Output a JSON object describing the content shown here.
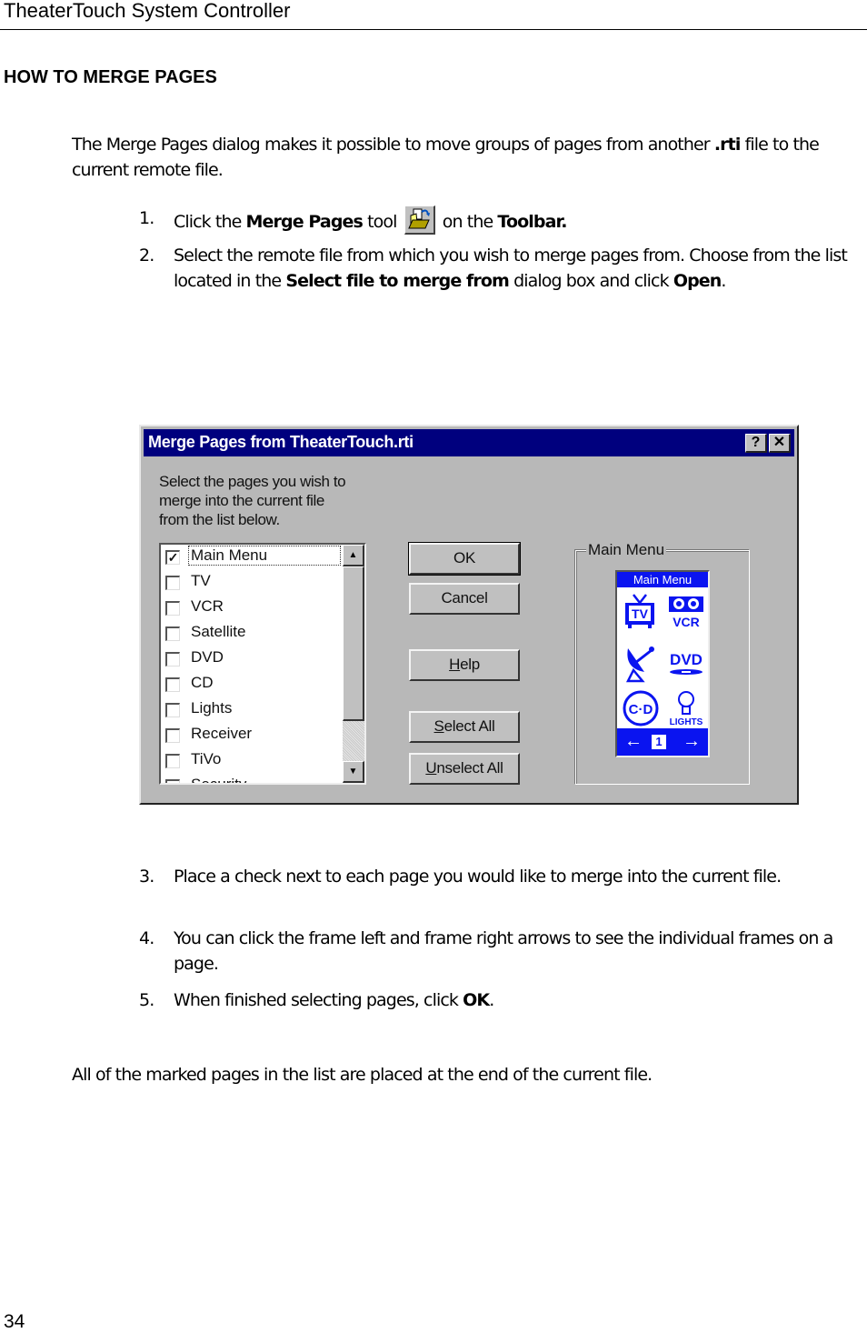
{
  "header": {
    "title": "TheaterTouch System Controller"
  },
  "section": {
    "heading": "HOW TO MERGE PAGES"
  },
  "intro": {
    "text_before": "The Merge Pages dialog makes it possible to move groups of pages from another ",
    "bold_ext": ".rti",
    "text_after": " file to the current remote file."
  },
  "steps": [
    {
      "num": "1.",
      "pre": "Click the ",
      "bold1": "Merge Pages",
      "mid": " tool ",
      "icon": "merge-pages-tool-icon",
      "post": " on the ",
      "bold2": "Toolbar."
    },
    {
      "num": "2.",
      "pre": "Select the remote file from which you wish to merge pages from. Choose from the list located in the ",
      "bold1": "Select file to merge from",
      "mid": " dialog box and click ",
      "bold2": "Open",
      "post": "."
    },
    {
      "num": "3.",
      "text": "Place a check next to each page you would like to merge into the current file."
    },
    {
      "num": "4.",
      "text": "You can click the frame left and frame right arrows to see the individual frames on a page."
    },
    {
      "num": "5.",
      "pre": "When finished selecting pages, click ",
      "bold1": "OK",
      "post": "."
    }
  ],
  "closing": "All of the marked pages in the list are placed at the end of the current file.",
  "page_number": "34",
  "dialog": {
    "title": "Merge Pages from TheaterTouch.rti",
    "help_btn": "?",
    "close_btn": "✕",
    "instructions": [
      "Select the pages you wish to",
      "merge into the current file",
      "from the list below."
    ],
    "pages": [
      {
        "label": "Main Menu",
        "checked": true
      },
      {
        "label": "TV",
        "checked": false
      },
      {
        "label": "VCR",
        "checked": false
      },
      {
        "label": "Satellite",
        "checked": false
      },
      {
        "label": "DVD",
        "checked": false
      },
      {
        "label": "CD",
        "checked": false
      },
      {
        "label": "Lights",
        "checked": false
      },
      {
        "label": "Receiver",
        "checked": false
      },
      {
        "label": "TiVo",
        "checked": false
      },
      {
        "label": "Security",
        "checked": false
      }
    ],
    "buttons": {
      "ok": "OK",
      "cancel": "Cancel",
      "help": {
        "u": "H",
        "rest": "elp"
      },
      "select_all": {
        "u": "S",
        "rest": "elect All"
      },
      "unselect_all": {
        "u": "U",
        "rest": "nselect All"
      }
    },
    "preview": {
      "group_label": "Main Menu",
      "screen_title": "Main Menu",
      "icons": [
        "tv-icon",
        "vcr-icon",
        "satellite-icon",
        "dvd-icon",
        "cd-icon",
        "lights-icon"
      ],
      "icon_labels": {
        "tv": "TV",
        "vcr": "VCR",
        "dvd": "DVD",
        "cd": "C·D",
        "lights": "LIGHTS"
      },
      "frame_number": "1",
      "left_arrow": "←",
      "right_arrow": "→",
      "accent": "#0a14f0"
    },
    "titlebar_color": "#00007e"
  }
}
